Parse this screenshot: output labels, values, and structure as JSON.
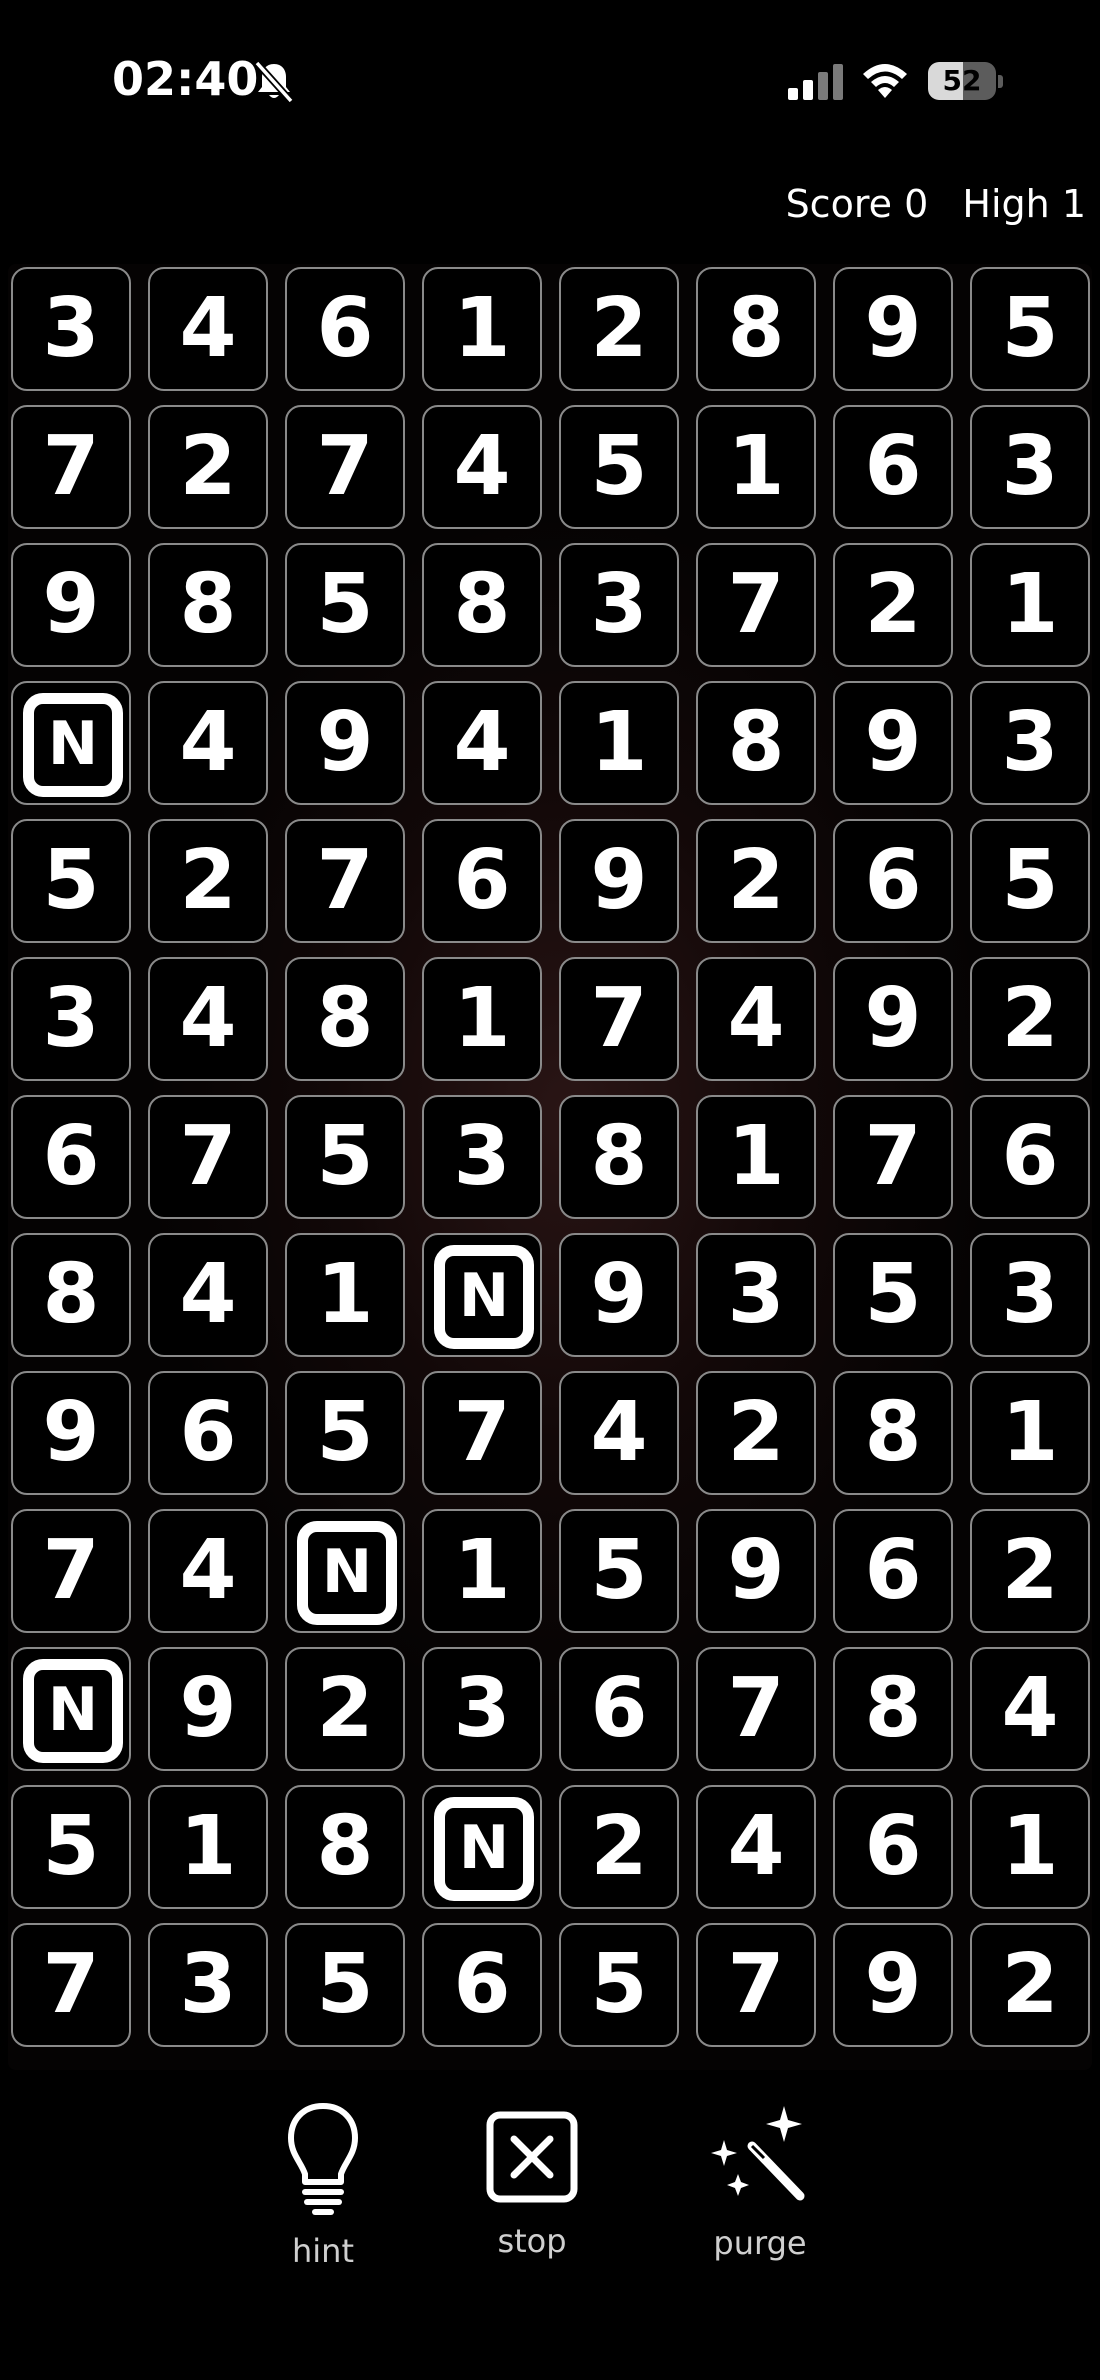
{
  "status_bar": {
    "time": "02:40",
    "battery_level": "52",
    "icons": [
      "bell-slash-icon",
      "signal-icon",
      "wifi-icon",
      "battery-icon"
    ]
  },
  "score": {
    "score_label": "Score",
    "score_value": "0",
    "high_label": "High",
    "high_value": "1"
  },
  "board": {
    "rows": [
      [
        "3",
        "4",
        "6",
        "1",
        "2",
        "8",
        "9",
        "5"
      ],
      [
        "7",
        "2",
        "7",
        "4",
        "5",
        "1",
        "6",
        "3"
      ],
      [
        "9",
        "8",
        "5",
        "8",
        "3",
        "7",
        "2",
        "1"
      ],
      [
        "N",
        "4",
        "9",
        "4",
        "1",
        "8",
        "9",
        "3"
      ],
      [
        "5",
        "2",
        "7",
        "6",
        "9",
        "2",
        "6",
        "5"
      ],
      [
        "3",
        "4",
        "8",
        "1",
        "7",
        "4",
        "9",
        "2"
      ],
      [
        "6",
        "7",
        "5",
        "3",
        "8",
        "1",
        "7",
        "6"
      ],
      [
        "8",
        "4",
        "1",
        "N",
        "9",
        "3",
        "5",
        "3"
      ],
      [
        "9",
        "6",
        "5",
        "7",
        "4",
        "2",
        "8",
        "1"
      ],
      [
        "7",
        "4",
        "N",
        "1",
        "5",
        "9",
        "6",
        "2"
      ],
      [
        "N",
        "9",
        "2",
        "3",
        "6",
        "7",
        "8",
        "4"
      ],
      [
        "5",
        "1",
        "8",
        "N",
        "2",
        "4",
        "6",
        "1"
      ],
      [
        "7",
        "3",
        "5",
        "6",
        "5",
        "7",
        "9",
        "2"
      ]
    ]
  },
  "toolbar": {
    "hint_label": "hint",
    "stop_label": "stop",
    "purge_label": "purge",
    "icons": [
      "lightbulb-icon",
      "close-box-icon",
      "magic-wand-icon"
    ]
  },
  "colors": {
    "background": "#000000",
    "tile_border": "#8a8a8a",
    "text": "#ffffff",
    "label": "#cfcfcf"
  }
}
